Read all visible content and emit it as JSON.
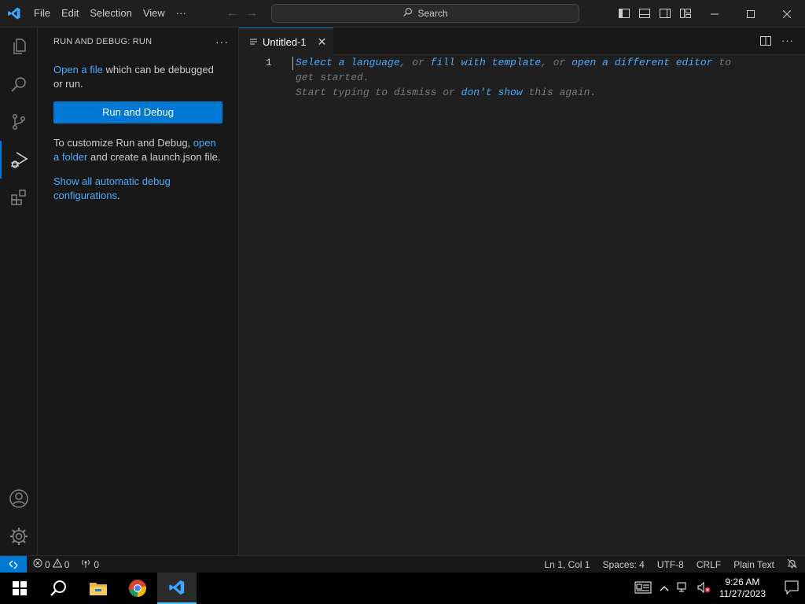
{
  "titlebar": {
    "menu": [
      "File",
      "Edit",
      "Selection",
      "View",
      "···"
    ],
    "search_label": "Search",
    "icons": {
      "logo": "vscode-logo-icon",
      "back": "arrow-left-icon",
      "forward": "arrow-right-icon",
      "search": "search-icon",
      "layout": [
        "toggle-primary-sidebar-icon",
        "toggle-panel-icon",
        "toggle-secondary-sidebar-icon",
        "customize-layout-icon"
      ],
      "window": [
        "minimize-icon",
        "maximize-icon",
        "close-icon"
      ]
    }
  },
  "activitybar": {
    "items": [
      "explorer-icon",
      "search-icon",
      "source-control-icon",
      "run-and-debug-icon",
      "extensions-icon"
    ],
    "bottom": [
      "accounts-icon",
      "manage-gear-icon"
    ],
    "active": "run-and-debug-icon"
  },
  "sidebar": {
    "title": "RUN AND DEBUG: RUN",
    "more": "···",
    "open_file_link": "Open a file",
    "open_file_rest": " which can be debugged or run.",
    "run_button": "Run and Debug",
    "customize_text": "To customize Run and Debug, ",
    "open_folder_link": "open a folder",
    "customize_rest": " and create a launch.json file.",
    "show_configs_link": "Show all automatic debug configurations",
    "show_configs_rest": "."
  },
  "editor": {
    "tab_label": "Untitled-1",
    "tab_close": "✕",
    "line_number": "1",
    "hint": {
      "select_language": "Select a language",
      "sep1": ", or ",
      "fill_template": "fill with template",
      "sep2": ", or ",
      "open_editor": "open a different editor",
      "tail1": " to get started.",
      "start_typing": "Start typing to dismiss or ",
      "dont_show": "don't show",
      "tail2": " this again."
    }
  },
  "statusbar": {
    "errors": "0",
    "warnings": "0",
    "ports": "0",
    "position": "Ln 1, Col 1",
    "spaces": "Spaces: 4",
    "encoding": "UTF-8",
    "eol": "CRLF",
    "language": "Plain Text"
  },
  "taskbar": {
    "apps": [
      "windows-start-icon",
      "search-icon",
      "file-explorer-icon",
      "chrome-icon",
      "vscode-icon"
    ],
    "time": "9:26 AM",
    "date": "11/27/2023"
  },
  "colors": {
    "accent": "#0078d4",
    "link": "#4daafc",
    "background": "#1f1f1f",
    "sidebar": "#181818"
  }
}
